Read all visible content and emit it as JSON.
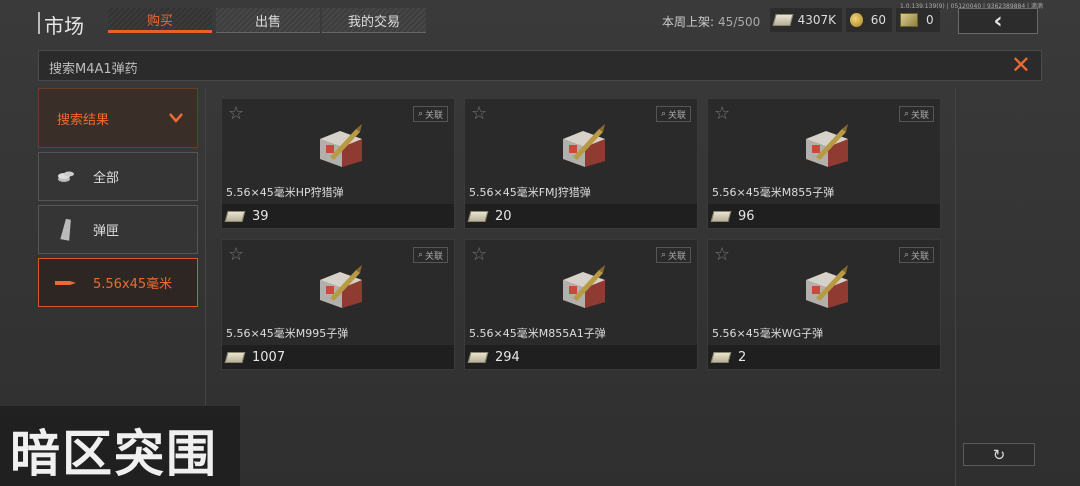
{
  "header": {
    "title": "市场",
    "tabs": [
      {
        "label": "购买",
        "active": true
      },
      {
        "label": "出售",
        "active": false
      },
      {
        "label": "我的交易",
        "active": false
      }
    ],
    "weekly_label": "本周上架:",
    "weekly_value": "45/500",
    "currencies": [
      {
        "icon": "cash-icon",
        "value": "4307K"
      },
      {
        "icon": "coin-icon",
        "value": "60"
      },
      {
        "icon": "bill-icon",
        "value": "0"
      }
    ],
    "version": "1.0.139.139(9) | 05120040 | 9362389884 | 滴滴",
    "back_icon": "‹"
  },
  "search": {
    "value": "搜索M4A1弹药",
    "close_icon": "✕"
  },
  "sidebar": {
    "header": "搜索结果",
    "items": [
      {
        "label": "全部",
        "icon": "coins-icon",
        "active": false
      },
      {
        "label": "弹匣",
        "icon": "magazine-icon",
        "active": false
      },
      {
        "label": "5.56x45毫米",
        "icon": "bullet-icon",
        "active": true
      }
    ]
  },
  "cards": [
    {
      "name": "5.56×45毫米HP狩猎弹",
      "price": "39",
      "link": "关联"
    },
    {
      "name": "5.56×45毫米FMJ狩猎弹",
      "price": "20",
      "link": "关联"
    },
    {
      "name": "5.56×45毫米M855子弹",
      "price": "96",
      "link": "关联"
    },
    {
      "name": "5.56×45毫米M995子弹",
      "price": "1007",
      "link": "关联"
    },
    {
      "name": "5.56×45毫米M855A1子弹",
      "price": "294",
      "link": "关联"
    },
    {
      "name": "5.56×45毫米WG子弹",
      "price": "2",
      "link": "关联"
    }
  ],
  "logo": "暗区突围",
  "refresh_icon": "↻"
}
